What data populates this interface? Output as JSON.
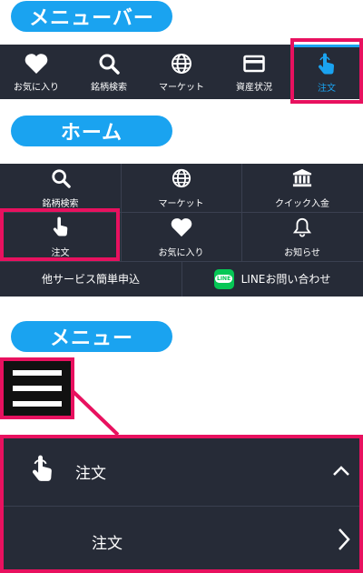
{
  "labels": {
    "menubar_pill": "メニューバー",
    "home_pill": "ホーム",
    "menu_pill": "メニュー"
  },
  "menubar": {
    "items": [
      {
        "label": "お気に入り",
        "icon": "heart-icon"
      },
      {
        "label": "銘柄検索",
        "icon": "search-icon"
      },
      {
        "label": "マーケット",
        "icon": "globe-icon"
      },
      {
        "label": "資産状況",
        "icon": "card-icon"
      },
      {
        "label": "注文",
        "icon": "hand-pointer-icon",
        "active": true
      }
    ]
  },
  "home": {
    "grid": [
      {
        "label": "銘柄検索",
        "icon": "search-icon"
      },
      {
        "label": "マーケット",
        "icon": "globe-icon"
      },
      {
        "label": "クイック入金",
        "icon": "bank-icon"
      },
      {
        "label": "注文",
        "icon": "hand-pointer-icon"
      },
      {
        "label": "お気に入り",
        "icon": "heart-icon"
      },
      {
        "label": "お知らせ",
        "icon": "bell-icon"
      }
    ],
    "bottom": {
      "left": "他サービス簡単申込",
      "right": "LINEお問い合わせ",
      "line_logo_text": "LINE"
    }
  },
  "menu": {
    "main_item": "注文",
    "sub_item": "注文"
  },
  "colors": {
    "accent": "#1aa3f0",
    "highlight": "#e8115f",
    "dark": "#262b37",
    "line_green": "#06c755"
  }
}
